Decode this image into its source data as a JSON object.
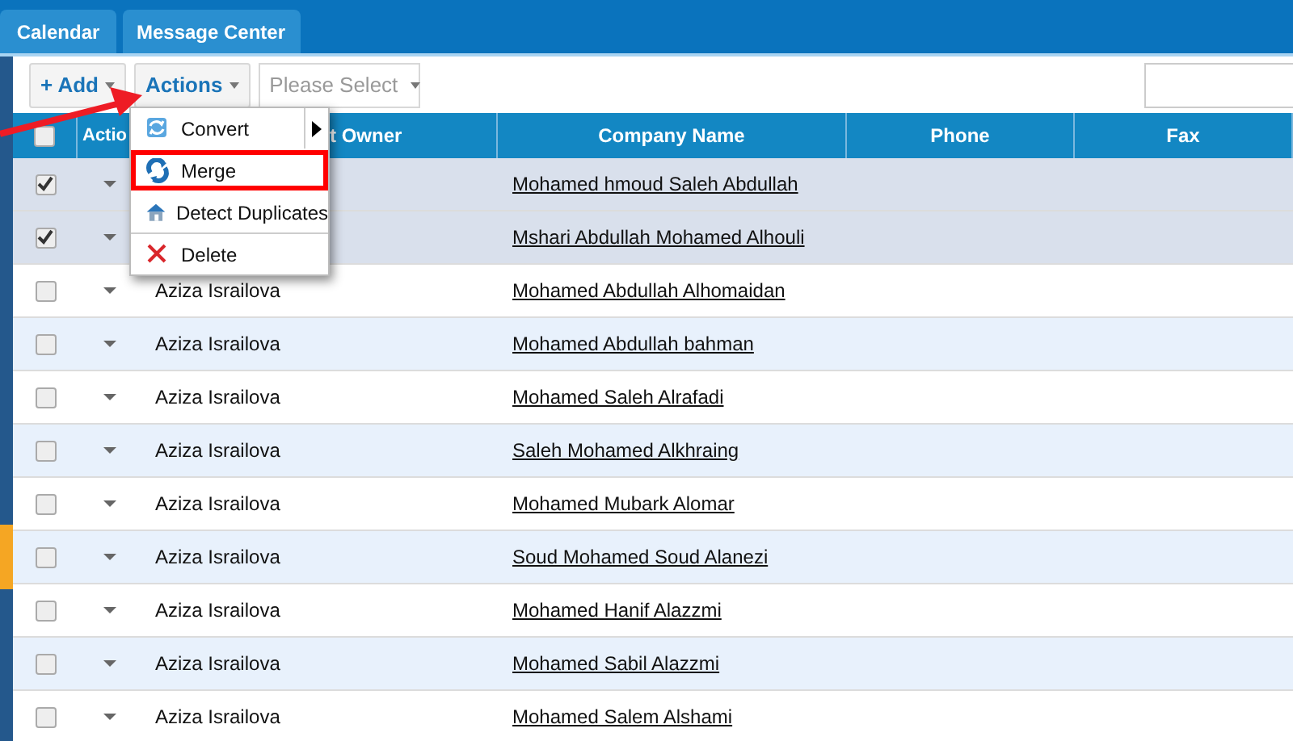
{
  "tabs": [
    {
      "label": "Calendar",
      "selected": false
    },
    {
      "label": "Message Center",
      "selected": false
    }
  ],
  "toolbar": {
    "add_button": "+ Add",
    "actions_button": "Actions",
    "filter": {
      "placeholder": "Please Select"
    }
  },
  "table": {
    "header_checkbox": {
      "checked": false
    },
    "columns": [
      "Actio",
      "t Owner",
      "Company Name",
      "Phone",
      "Fax"
    ],
    "rows": [
      {
        "checked": true,
        "selected": true,
        "company": "Mohamed hmoud Saleh Abdullah"
      },
      {
        "checked": true,
        "selected": true,
        "company": "Mshari Abdullah Mohamed Alhouli"
      },
      {
        "checked": false,
        "selected": false,
        "owner": "Aziza Israilova",
        "company": "Mohamed Abdullah Alhomaidan"
      },
      {
        "checked": false,
        "selected": false,
        "owner": "Aziza Israilova",
        "company": "Mohamed Abdullah bahman"
      },
      {
        "checked": false,
        "selected": false,
        "owner": "Aziza Israilova",
        "company": "Mohamed Saleh Alrafadi"
      },
      {
        "checked": false,
        "selected": false,
        "owner": "Aziza Israilova",
        "company": "Saleh Mohamed Alkhraing"
      },
      {
        "checked": false,
        "selected": false,
        "owner": "Aziza Israilova",
        "company": "Mohamed Mubark Alomar"
      },
      {
        "checked": false,
        "selected": false,
        "owner": "Aziza Israilova",
        "company": "Soud Mohamed Soud Alanezi"
      },
      {
        "checked": false,
        "selected": false,
        "owner": "Aziza Israilova",
        "company": "Mohamed Hanif Alazzmi"
      },
      {
        "checked": false,
        "selected": false,
        "owner": "Aziza Israilova",
        "company": "Mohamed Sabil Alazzmi"
      },
      {
        "checked": false,
        "selected": false,
        "owner": "Aziza Israilova",
        "company": "Mohamed Salem Alshami"
      }
    ]
  },
  "actions_menu": {
    "items": [
      {
        "kind": "convert",
        "label": "Convert",
        "has_submenu": true,
        "highlighted": false,
        "separator_before": false
      },
      {
        "kind": "merge",
        "label": "Merge",
        "has_submenu": false,
        "highlighted": true,
        "separator_before": false
      },
      {
        "kind": "detect",
        "label": "Detect Duplicates",
        "has_submenu": false,
        "highlighted": false,
        "separator_before": false
      },
      {
        "kind": "delete",
        "label": "Delete",
        "has_submenu": false,
        "highlighted": false,
        "separator_before": true
      }
    ]
  }
}
